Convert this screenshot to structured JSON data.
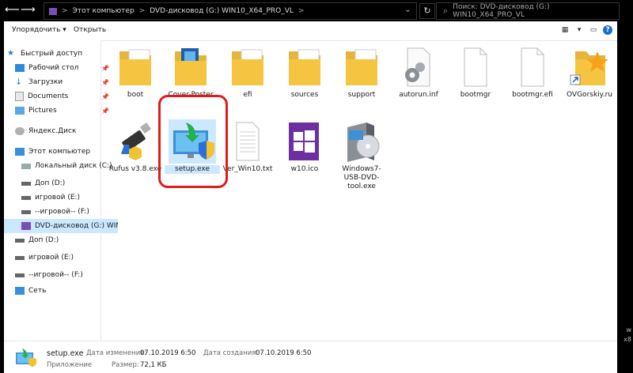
{
  "address": {
    "crumbs": [
      "Этот компьютер",
      "DVD-дисковод (G:) WIN10_X64_PRO_VL"
    ],
    "separator": ">",
    "search_placeholder": "Поиск: DVD-дисковод (G:) WIN10_X64_PRO_VL"
  },
  "ribbon": {
    "organize_label": "Упорядочить ▾",
    "open_label": "Открыть"
  },
  "nav": {
    "quick_access": "Быстрый доступ",
    "desktop": "Рабочий стол",
    "downloads": "Загрузки",
    "documents": "Documents",
    "pictures": "Pictures",
    "yandex": "Яндекс.Диск",
    "this_pc": "Этот компьютер",
    "local_c": "Локальный диск (C:)",
    "dop_d": "Доп (D:)",
    "igrovoy_e": "игровой (E:)",
    "igrovoy_f": "--игровой-- (F:)",
    "dvd_g": "DVD-дисковод (G:) WIN1",
    "dop_d2": "Доп (D:)",
    "igrovoy_e2": "игровой (E:)",
    "igrovoy_f2": "--игровой-- (F:)",
    "network": "Сеть"
  },
  "files": [
    {
      "name": "boot",
      "icon": "folder-icon"
    },
    {
      "name": "Cover-Poster",
      "icon": "folder-icon"
    },
    {
      "name": "efi",
      "icon": "folder-icon"
    },
    {
      "name": "sources",
      "icon": "folder-icon"
    },
    {
      "name": "support",
      "icon": "folder-icon"
    },
    {
      "name": "autorun.inf",
      "icon": "settings-file-icon"
    },
    {
      "name": "bootmgr",
      "icon": "blank-file-icon"
    },
    {
      "name": "bootmgr.efi",
      "icon": "blank-file-icon"
    },
    {
      "name": "OVGorskiy.ru",
      "icon": "shortcut-icon"
    },
    {
      "name": "Rufus v3.8.exe",
      "icon": "usb-drive-icon"
    },
    {
      "name": "setup.exe",
      "icon": "setup-icon"
    },
    {
      "name": "Ver_Win10.txt",
      "icon": "text-file-icon"
    },
    {
      "name": "w10.ico",
      "icon": "windows-logo-icon"
    },
    {
      "name": "Windows7-USB-DVD-tool.exe",
      "icon": "disc-box-icon"
    }
  ],
  "status": {
    "file_name": "setup.exe",
    "file_type": "Приложение",
    "modified_label": "Дата изменения:",
    "modified_value": "07.10.2019 6:50",
    "created_label": "Дата создания:",
    "created_value": "07.10.2019 6:50",
    "size_label": "Размер:",
    "size_value": "72,1 КБ"
  },
  "side_text": {
    "w": "w",
    "x8": "x8"
  },
  "colors": {
    "selection": "#cce8ff",
    "highlight_ring": "#e01b1b",
    "folder": "#f5c441"
  }
}
